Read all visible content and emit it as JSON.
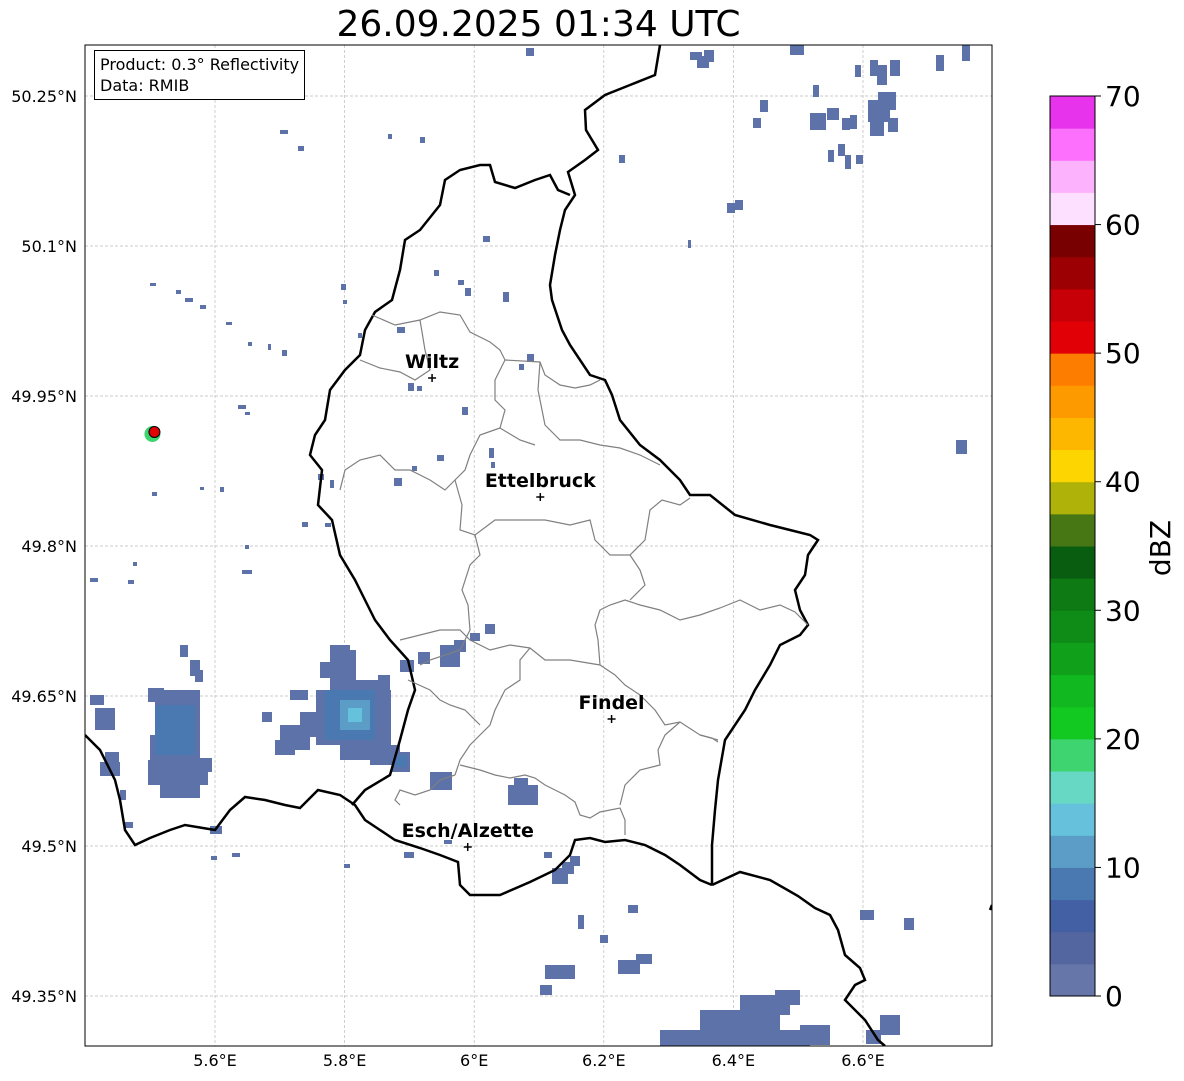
{
  "title": "26.09.2025 01:34 UTC",
  "info": {
    "product": "Product: 0.3° Reflectivity",
    "data": "Data: RMIB"
  },
  "map": {
    "lon_range": [
      5.4,
      6.8
    ],
    "lat_range": [
      49.3,
      50.3
    ],
    "lon_ticks": [
      5.6,
      5.8,
      6.0,
      6.2,
      6.4,
      6.6
    ],
    "lon_tick_labels": [
      "5.6°E",
      "5.8°E",
      "6°E",
      "6.2°E",
      "6.4°E",
      "6.6°E"
    ],
    "lat_ticks": [
      49.35,
      49.5,
      49.65,
      49.8,
      49.95,
      50.1,
      50.25
    ],
    "lat_tick_labels": [
      "49.35°N",
      "49.5°N",
      "49.65°N",
      "49.8°N",
      "49.95°N",
      "50.1°N",
      "50.25°N"
    ],
    "grid": true,
    "cities": [
      {
        "name": "Wiltz",
        "lon": 5.935,
        "lat": 49.968
      },
      {
        "name": "Ettelbruck",
        "lon": 6.102,
        "lat": 49.849
      },
      {
        "name": "Findel",
        "lon": 6.212,
        "lat": 49.627
      },
      {
        "name": "Esch/Alzette",
        "lon": 5.99,
        "lat": 49.499
      }
    ],
    "radar_site": {
      "lon": 5.505,
      "lat": 49.914
    }
  },
  "colorbar": {
    "label": "dBZ",
    "min": 0,
    "max": 70,
    "ticks": [
      0,
      10,
      20,
      30,
      40,
      50,
      60,
      70
    ],
    "colors": [
      "#6776a8",
      "#5366a0",
      "#4460a5",
      "#4a79b2",
      "#5b9dc6",
      "#66c2dc",
      "#66d8c4",
      "#3ed46f",
      "#11c920",
      "#11b820",
      "#11a01a",
      "#0f8c17",
      "#0e7a13",
      "#095d10",
      "#467714",
      "#afb208",
      "#fdd500",
      "#fdb700",
      "#fd9a00",
      "#fd7d00",
      "#e10005",
      "#c60006",
      "#9c0003",
      "#780001",
      "#fde0ff",
      "#fdb2fd",
      "#fd6ffd",
      "#e733ec"
    ]
  }
}
